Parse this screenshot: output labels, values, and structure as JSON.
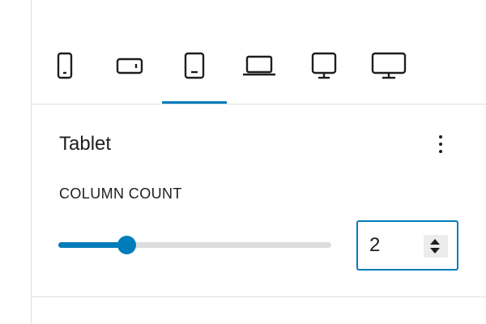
{
  "devices": [
    {
      "name": "mobile-portrait",
      "icon": "mobile-portrait-icon",
      "active": false
    },
    {
      "name": "mobile-landscape",
      "icon": "mobile-landscape-icon",
      "active": false
    },
    {
      "name": "tablet",
      "icon": "tablet-icon",
      "active": true
    },
    {
      "name": "laptop",
      "icon": "laptop-icon",
      "active": false
    },
    {
      "name": "desktop",
      "icon": "desktop-icon",
      "active": false
    },
    {
      "name": "wide-desktop",
      "icon": "wide-desktop-icon",
      "active": false
    }
  ],
  "section": {
    "title": "Tablet",
    "menu_icon": "more-vertical-icon"
  },
  "column_count": {
    "label": "COLUMN COUNT",
    "value": "2",
    "slider_fraction": 0.25
  },
  "colors": {
    "accent": "#007cba",
    "text": "#1e1e1e",
    "border": "#e0e0e0",
    "rail": "#dddddd"
  }
}
